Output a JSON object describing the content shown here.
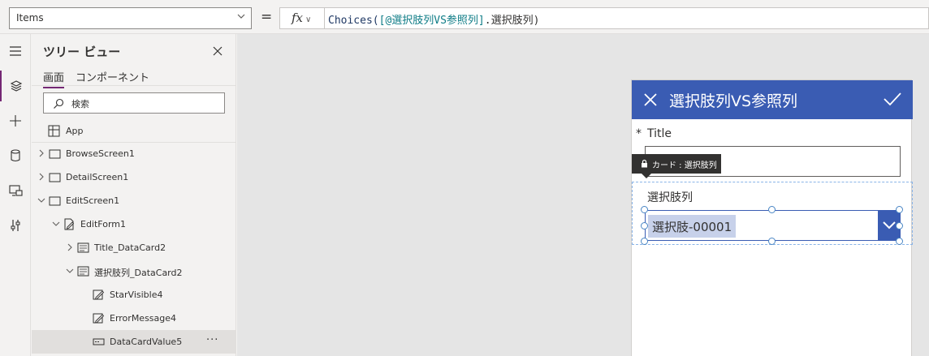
{
  "formula_bar": {
    "property": "Items",
    "equals": "=",
    "fx": "fx",
    "formula_fn": "Choices(",
    "formula_ref": "[@選択肢列VS参照列]",
    "formula_rest": ".選択肢列)"
  },
  "left_rail": {
    "items": [
      {
        "icon": "hamburger-menu-icon"
      },
      {
        "icon": "layers-icon",
        "active": true
      },
      {
        "icon": "plus-icon"
      },
      {
        "icon": "database-icon"
      },
      {
        "icon": "media-icon"
      },
      {
        "icon": "tools-icon"
      }
    ]
  },
  "tree_view": {
    "title": "ツリー ビュー",
    "tabs": [
      "画面",
      "コンポーネント"
    ],
    "search_placeholder": "検索",
    "app_label": "App",
    "items": [
      {
        "label": "BrowseScreen1",
        "expanded": false,
        "icon": "screen-icon"
      },
      {
        "label": "DetailScreen1",
        "expanded": false,
        "icon": "screen-icon"
      },
      {
        "label": "EditScreen1",
        "expanded": true,
        "icon": "screen-icon"
      },
      {
        "label": "EditForm1",
        "expanded": true,
        "icon": "form-icon"
      },
      {
        "label": "Title_DataCard2",
        "expanded": false,
        "icon": "card-icon"
      },
      {
        "label": "選択肢列_DataCard2",
        "expanded": true,
        "icon": "card-icon"
      },
      {
        "label": "StarVisible4",
        "icon": "edit-text-icon"
      },
      {
        "label": "ErrorMessage4",
        "icon": "edit-text-icon"
      },
      {
        "label": "DataCardValue5",
        "icon": "combobox-icon",
        "selected": true
      }
    ],
    "more": "···"
  },
  "app_screen": {
    "header_title": "選択肢列VS参照列",
    "header_color": "#3a5cb3",
    "title_required_star": "*",
    "title_label": "Title",
    "card_tooltip": "カード : 選択肢列",
    "choice_label": "選択肢列",
    "choice_value": "選択肢-00001"
  }
}
